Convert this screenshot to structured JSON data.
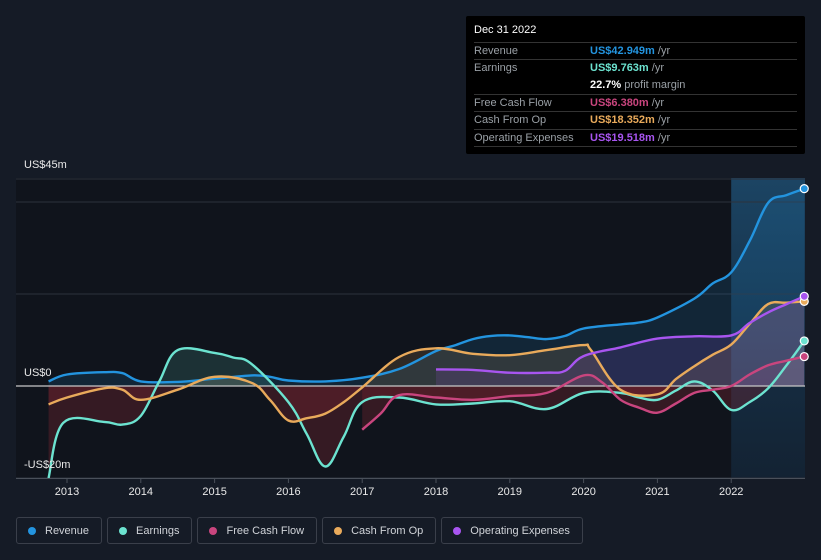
{
  "tooltip": {
    "date": "Dec 31 2022",
    "rows": [
      {
        "label": "Revenue",
        "value": "US$42.949m",
        "unit": " /yr",
        "color": "#2394df"
      },
      {
        "label": "Earnings",
        "value": "US$9.763m",
        "unit": " /yr",
        "color": "#6ce3d0"
      },
      {
        "label": "",
        "value": "22.7%",
        "unit": " profit margin",
        "color": "#ffffff"
      },
      {
        "label": "Free Cash Flow",
        "value": "US$6.380m",
        "unit": " /yr",
        "color": "#c9457e"
      },
      {
        "label": "Cash From Op",
        "value": "US$18.352m",
        "unit": " /yr",
        "color": "#e9aa5b"
      },
      {
        "label": "Operating Expenses",
        "value": "US$19.518m",
        "unit": " /yr",
        "color": "#a855f0"
      }
    ]
  },
  "legend": [
    {
      "label": "Revenue",
      "color": "#2394df"
    },
    {
      "label": "Earnings",
      "color": "#6ce3d0"
    },
    {
      "label": "Free Cash Flow",
      "color": "#c9457e"
    },
    {
      "label": "Cash From Op",
      "color": "#e9aa5b"
    },
    {
      "label": "Operating Expenses",
      "color": "#a855f0"
    }
  ],
  "chart_data": {
    "type": "line",
    "title": "",
    "xlabel": "",
    "ylabel": "",
    "y_tick_labels": [
      "US$45m",
      "US$0",
      "-US$20m"
    ],
    "ylim": [
      -20,
      45
    ],
    "xlim": [
      2012.6,
      2023.0
    ],
    "x_tick_labels": [
      "2013",
      "2014",
      "2015",
      "2016",
      "2017",
      "2018",
      "2019",
      "2020",
      "2021",
      "2022"
    ],
    "forecast_shade_start": 2022.0,
    "grid": true,
    "legend_position": "bottom-left",
    "series": [
      {
        "name": "Revenue",
        "color": "#2394df",
        "x": [
          2012.75,
          2013.0,
          2013.5,
          2013.75,
          2014.0,
          2014.5,
          2015.0,
          2015.5,
          2015.75,
          2016.0,
          2016.5,
          2017.0,
          2017.5,
          2018.0,
          2018.25,
          2018.5,
          2018.75,
          2019.0,
          2019.25,
          2019.5,
          2019.75,
          2020.0,
          2020.5,
          2020.75,
          2021.0,
          2021.5,
          2021.75,
          2022.0,
          2022.25,
          2022.5,
          2022.75,
          2022.99
        ],
        "y": [
          1.0,
          2.5,
          3.0,
          2.8,
          1.0,
          0.9,
          1.6,
          2.3,
          2.0,
          1.2,
          1.0,
          1.8,
          3.7,
          7.6,
          8.8,
          10.2,
          10.9,
          11.0,
          10.6,
          10.2,
          10.9,
          12.5,
          13.4,
          13.8,
          14.9,
          19.0,
          22.3,
          24.7,
          31.5,
          39.8,
          41.5,
          42.9
        ]
      },
      {
        "name": "Earnings",
        "color": "#6ce3d0",
        "x": [
          2012.75,
          2012.95,
          2013.5,
          2013.75,
          2014.0,
          2014.25,
          2014.5,
          2015.0,
          2015.25,
          2015.5,
          2016.0,
          2016.25,
          2016.5,
          2016.75,
          2017.0,
          2017.5,
          2018.0,
          2018.5,
          2019.0,
          2019.5,
          2020.0,
          2020.5,
          2020.75,
          2021.0,
          2021.25,
          2021.5,
          2021.75,
          2022.0,
          2022.25,
          2022.5,
          2022.75,
          2022.99
        ],
        "y": [
          -20.0,
          -8.0,
          -7.8,
          -8.4,
          -6.5,
          1.0,
          7.8,
          7.2,
          6.2,
          4.8,
          -3.5,
          -10.5,
          -17.5,
          -11.0,
          -3.5,
          -2.5,
          -4.0,
          -3.8,
          -3.3,
          -5.0,
          -1.5,
          -1.5,
          -2.5,
          -3.0,
          -1.0,
          1.0,
          -1.0,
          -5.2,
          -3.5,
          -0.5,
          4.5,
          9.8
        ]
      },
      {
        "name": "Free Cash Flow",
        "color": "#c9457e",
        "x": [
          2017.0,
          2017.25,
          2017.5,
          2018.0,
          2018.5,
          2019.0,
          2019.5,
          2020.0,
          2020.25,
          2020.5,
          2020.75,
          2021.0,
          2021.25,
          2021.5,
          2021.75,
          2022.0,
          2022.25,
          2022.5,
          2022.75,
          2022.99
        ],
        "y": [
          -9.5,
          -6.0,
          -2.0,
          -2.5,
          -3.0,
          -2.2,
          -1.5,
          2.3,
          0.8,
          -3.0,
          -4.7,
          -5.8,
          -3.8,
          -1.5,
          -0.8,
          0.0,
          2.5,
          4.5,
          5.5,
          6.4
        ]
      },
      {
        "name": "Cash From Op",
        "color": "#e9aa5b",
        "x": [
          2012.75,
          2013.0,
          2013.5,
          2013.75,
          2014.0,
          2014.5,
          2015.0,
          2015.5,
          2015.75,
          2016.0,
          2016.25,
          2016.5,
          2016.75,
          2017.0,
          2017.5,
          2018.0,
          2018.5,
          2019.0,
          2019.5,
          2020.0,
          2020.1,
          2020.5,
          2021.0,
          2021.25,
          2021.5,
          2021.75,
          2022.0,
          2022.25,
          2022.5,
          2022.75,
          2022.99
        ],
        "y": [
          -4.0,
          -2.5,
          -0.5,
          -0.8,
          -3.0,
          -0.8,
          2.0,
          0.7,
          -3.0,
          -7.5,
          -7.0,
          -6.0,
          -3.5,
          -0.3,
          6.3,
          8.2,
          7.0,
          6.7,
          7.8,
          8.9,
          7.8,
          -0.8,
          -1.8,
          1.5,
          4.3,
          6.8,
          9.0,
          13.5,
          17.8,
          18.1,
          18.4
        ]
      },
      {
        "name": "Operating Expenses",
        "color": "#a855f0",
        "x": [
          2018.0,
          2018.5,
          2019.0,
          2019.5,
          2019.75,
          2020.0,
          2020.5,
          2021.0,
          2021.5,
          2022.0,
          2022.25,
          2022.5,
          2022.75,
          2022.99
        ],
        "y": [
          3.6,
          3.5,
          2.9,
          2.9,
          3.3,
          6.5,
          8.4,
          10.3,
          10.8,
          11.0,
          13.7,
          16.0,
          17.8,
          19.5
        ]
      }
    ]
  }
}
